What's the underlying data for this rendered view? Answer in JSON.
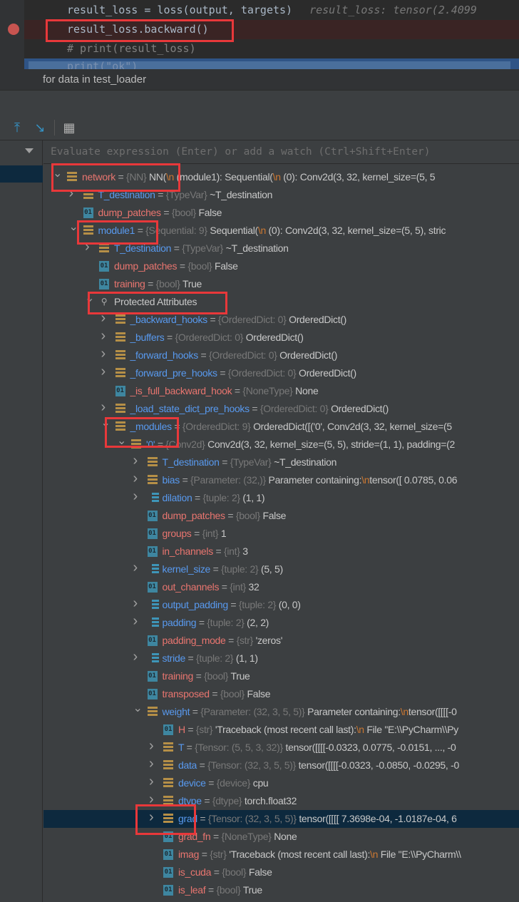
{
  "editor": {
    "lines": [
      {
        "code": "result_loss = loss(output, targets)",
        "hint": "result_loss: tensor(2.4099"
      },
      {
        "code": "result_loss.backward()"
      },
      {
        "comment": "# print(result_loss)"
      },
      {
        "code": "print(\"ok\")"
      }
    ]
  },
  "breadcrumb": "for data in test_loader",
  "toolbar": {
    "icons": [
      "show-execution-point-icon",
      "step-into-cursor-icon",
      "evaluate-calculator-icon"
    ]
  },
  "evaluate": {
    "placeholder": "Evaluate expression (Enter) or add a watch (Ctrl+Shift+Enter)"
  },
  "colors": {
    "accent_red_box": "#e8383a",
    "name_red": "#e8756f",
    "name_blue": "#5899ee",
    "selected_row": "#0d293e",
    "breakpoint": "#c75450"
  },
  "tree": [
    {
      "l": 0,
      "a": "e",
      "i": "struct",
      "c": "red",
      "n": "network",
      "t": "{NN}",
      "v": "NN(\\n  (module1): Sequential(\\n    (0): Conv2d(3, 32, kernel_size=(5, 5"
    },
    {
      "l": 1,
      "a": "c",
      "i": "struct",
      "c": "blue",
      "n": "T_destination",
      "t": "{TypeVar}",
      "v": "~T_destination"
    },
    {
      "l": 1,
      "a": "",
      "i": "field",
      "c": "red",
      "n": "dump_patches",
      "t": "{bool}",
      "v": "False"
    },
    {
      "l": 1,
      "a": "e",
      "i": "struct",
      "c": "blue",
      "n": "module1",
      "t": "{Sequential: 9}",
      "v": "Sequential(\\n  (0): Conv2d(3, 32, kernel_size=(5, 5), stric"
    },
    {
      "l": 2,
      "a": "c",
      "i": "struct",
      "c": "blue",
      "n": "T_destination",
      "t": "{TypeVar}",
      "v": "~T_destination"
    },
    {
      "l": 2,
      "a": "",
      "i": "field",
      "c": "red",
      "n": "dump_patches",
      "t": "{bool}",
      "v": "False"
    },
    {
      "l": 2,
      "a": "",
      "i": "field",
      "c": "red",
      "n": "training",
      "t": "{bool}",
      "v": "True"
    },
    {
      "l": 2,
      "a": "e",
      "i": "key",
      "c": "plain",
      "n": "Protected Attributes"
    },
    {
      "l": 3,
      "a": "c",
      "i": "struct",
      "c": "blue",
      "n": "_backward_hooks",
      "t": "{OrderedDict: 0}",
      "v": "OrderedDict()"
    },
    {
      "l": 3,
      "a": "c",
      "i": "struct",
      "c": "blue",
      "n": "_buffers",
      "t": "{OrderedDict: 0}",
      "v": "OrderedDict()"
    },
    {
      "l": 3,
      "a": "c",
      "i": "struct",
      "c": "blue",
      "n": "_forward_hooks",
      "t": "{OrderedDict: 0}",
      "v": "OrderedDict()"
    },
    {
      "l": 3,
      "a": "c",
      "i": "struct",
      "c": "blue",
      "n": "_forward_pre_hooks",
      "t": "{OrderedDict: 0}",
      "v": "OrderedDict()"
    },
    {
      "l": 3,
      "a": "",
      "i": "field",
      "c": "red",
      "n": "_is_full_backward_hook",
      "t": "{NoneType}",
      "v": "None"
    },
    {
      "l": 3,
      "a": "c",
      "i": "struct",
      "c": "blue",
      "n": "_load_state_dict_pre_hooks",
      "t": "{OrderedDict: 0}",
      "v": "OrderedDict()"
    },
    {
      "l": 3,
      "a": "e",
      "i": "struct",
      "c": "blue",
      "n": "_modules",
      "t": "{OrderedDict: 9}",
      "v": "OrderedDict([('0', Conv2d(3, 32, kernel_size=(5"
    },
    {
      "l": 4,
      "a": "e",
      "i": "struct",
      "c": "blue",
      "n": "'0'",
      "t": "{Conv2d}",
      "v": "Conv2d(3, 32, kernel_size=(5, 5), stride=(1, 1), padding=(2"
    },
    {
      "l": 5,
      "a": "c",
      "i": "struct",
      "c": "blue",
      "n": "T_destination",
      "t": "{TypeVar}",
      "v": "~T_destination"
    },
    {
      "l": 5,
      "a": "c",
      "i": "struct",
      "c": "blue",
      "n": "bias",
      "t": "{Parameter: (32,)}",
      "v": "Parameter containing:\\ntensor([ 0.0785,  0.06"
    },
    {
      "l": 5,
      "a": "c",
      "i": "tuple",
      "c": "blue",
      "n": "dilation",
      "t": "{tuple: 2}",
      "v": "(1, 1)"
    },
    {
      "l": 5,
      "a": "",
      "i": "field",
      "c": "red",
      "n": "dump_patches",
      "t": "{bool}",
      "v": "False"
    },
    {
      "l": 5,
      "a": "",
      "i": "field",
      "c": "red",
      "n": "groups",
      "t": "{int}",
      "v": "1"
    },
    {
      "l": 5,
      "a": "",
      "i": "field",
      "c": "red",
      "n": "in_channels",
      "t": "{int}",
      "v": "3"
    },
    {
      "l": 5,
      "a": "c",
      "i": "tuple",
      "c": "blue",
      "n": "kernel_size",
      "t": "{tuple: 2}",
      "v": "(5, 5)"
    },
    {
      "l": 5,
      "a": "",
      "i": "field",
      "c": "red",
      "n": "out_channels",
      "t": "{int}",
      "v": "32"
    },
    {
      "l": 5,
      "a": "c",
      "i": "tuple",
      "c": "blue",
      "n": "output_padding",
      "t": "{tuple: 2}",
      "v": "(0, 0)"
    },
    {
      "l": 5,
      "a": "c",
      "i": "tuple",
      "c": "blue",
      "n": "padding",
      "t": "{tuple: 2}",
      "v": "(2, 2)"
    },
    {
      "l": 5,
      "a": "",
      "i": "field",
      "c": "red",
      "n": "padding_mode",
      "t": "{str}",
      "v": "'zeros'"
    },
    {
      "l": 5,
      "a": "c",
      "i": "tuple",
      "c": "blue",
      "n": "stride",
      "t": "{tuple: 2}",
      "v": "(1, 1)"
    },
    {
      "l": 5,
      "a": "",
      "i": "field",
      "c": "red",
      "n": "training",
      "t": "{bool}",
      "v": "True"
    },
    {
      "l": 5,
      "a": "",
      "i": "field",
      "c": "red",
      "n": "transposed",
      "t": "{bool}",
      "v": "False"
    },
    {
      "l": 5,
      "a": "e",
      "i": "struct",
      "c": "blue",
      "n": "weight",
      "t": "{Parameter: (32, 3, 5, 5)}",
      "v": "Parameter containing:\\ntensor([[[[-0"
    },
    {
      "l": 6,
      "a": "",
      "i": "field",
      "c": "red",
      "n": "H",
      "t": "{str}",
      "v": "'Traceback (most recent call last):\\n  File \"E:\\\\PyCharm\\\\Py"
    },
    {
      "l": 6,
      "a": "c",
      "i": "struct",
      "c": "blue",
      "n": "T",
      "t": "{Tensor: (5, 5, 3, 32)}",
      "v": "tensor([[[[-0.0323,  0.0775, -0.0151,  ..., -0"
    },
    {
      "l": 6,
      "a": "c",
      "i": "struct",
      "c": "blue",
      "n": "data",
      "t": "{Tensor: (32, 3, 5, 5)}",
      "v": "tensor([[[[-0.0323, -0.0850, -0.0295, -0"
    },
    {
      "l": 6,
      "a": "c",
      "i": "struct",
      "c": "blue",
      "n": "device",
      "t": "{device}",
      "v": "cpu"
    },
    {
      "l": 6,
      "a": "c",
      "i": "struct",
      "c": "blue",
      "n": "dtype",
      "t": "{dtype}",
      "v": "torch.float32"
    },
    {
      "l": 6,
      "a": "c",
      "i": "struct",
      "c": "blue",
      "n": "grad",
      "t": "{Tensor: (32, 3, 5, 5)}",
      "v": "tensor([[[[ 7.3698e-04, -1.0187e-04,  6",
      "sel": true
    },
    {
      "l": 6,
      "a": "",
      "i": "field",
      "c": "red",
      "n": "grad_fn",
      "t": "{NoneType}",
      "v": "None"
    },
    {
      "l": 6,
      "a": "",
      "i": "field",
      "c": "red",
      "n": "imag",
      "t": "{str}",
      "v": "'Traceback (most recent call last):\\n  File \"E:\\\\PyCharm\\\\"
    },
    {
      "l": 6,
      "a": "",
      "i": "field",
      "c": "red",
      "n": "is_cuda",
      "t": "{bool}",
      "v": "False"
    },
    {
      "l": 6,
      "a": "",
      "i": "field",
      "c": "red",
      "n": "is_leaf",
      "t": "{bool}",
      "v": "True"
    }
  ]
}
